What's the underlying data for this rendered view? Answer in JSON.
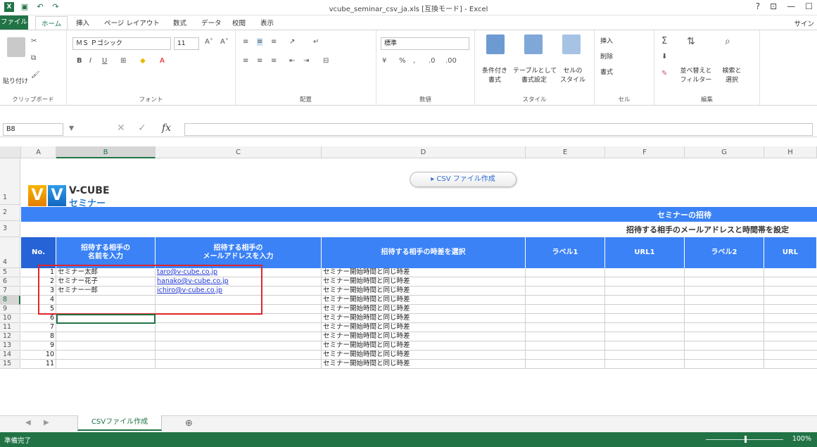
{
  "window": {
    "title": "vcube_seminar_csv_ja.xls [互換モード] - Excel",
    "controls": [
      "?",
      "⊡",
      "—",
      "☐"
    ]
  },
  "tabs": {
    "file": "ファイル",
    "items": [
      "ホーム",
      "挿入",
      "ページ レイアウト",
      "数式",
      "データ",
      "校閲",
      "表示"
    ],
    "signin": "サイン"
  },
  "ribbon": {
    "clipboard": {
      "paste": "貼り付け",
      "label": "クリップボード"
    },
    "font": {
      "name": "ＭＳ Ｐゴシック",
      "size": "11",
      "label": "フォント"
    },
    "alignment": {
      "label": "配置"
    },
    "number": {
      "format": "標準",
      "label": "数値"
    },
    "styles": {
      "conditional": "条件付き\n書式",
      "table": "テーブルとして\n書式設定",
      "cell": "セルの\nスタイル",
      "label": "スタイル"
    },
    "cells": {
      "insert": "挿入",
      "delete": "削除",
      "format": "書式",
      "label": "セル"
    },
    "editing": {
      "sort": "並べ替えと\nフィルター",
      "find": "検索と\n選択",
      "label": "編集"
    }
  },
  "formula": {
    "namebox": "B8",
    "value": ""
  },
  "columns": [
    "A",
    "B",
    "C",
    "D",
    "E",
    "F",
    "G",
    "H"
  ],
  "rows": [
    "1",
    "2",
    "3",
    "4",
    "5",
    "6",
    "7",
    "8",
    "9",
    "10",
    "11",
    "12",
    "13",
    "14",
    "15"
  ],
  "logo": {
    "line1": "V-CUBE",
    "line2": "セミナー"
  },
  "csv_button": "▸ CSV ファイル作成",
  "banner": "セミナーの招待",
  "subtitle": "招待する相手のメールアドレスと時間帯を設定",
  "headers": {
    "no": "No.",
    "name": "招待する相手の\n名前を入力",
    "email": "招待する相手の\nメールアドレスを入力",
    "timezone": "招待する相手の時差を選択",
    "label1": "ラベル1",
    "url1": "URL1",
    "label2": "ラベル2",
    "url2": "URL"
  },
  "records": [
    {
      "no": "1",
      "name": "セミナー太郎",
      "email": "taro@v-cube.co.jp",
      "tz": "セミナー開始時間と同じ時差"
    },
    {
      "no": "2",
      "name": "セミナー花子",
      "email": "hanako@v-cube.co.jp",
      "tz": "セミナー開始時間と同じ時差"
    },
    {
      "no": "3",
      "name": "セミナー一郎",
      "email": "ichiro@v-cube.co.jp",
      "tz": "セミナー開始時間と同じ時差"
    },
    {
      "no": "4",
      "name": "",
      "email": "",
      "tz": "セミナー開始時間と同じ時差"
    },
    {
      "no": "5",
      "name": "",
      "email": "",
      "tz": "セミナー開始時間と同じ時差"
    },
    {
      "no": "6",
      "name": "",
      "email": "",
      "tz": "セミナー開始時間と同じ時差"
    },
    {
      "no": "7",
      "name": "",
      "email": "",
      "tz": "セミナー開始時間と同じ時差"
    },
    {
      "no": "8",
      "name": "",
      "email": "",
      "tz": "セミナー開始時間と同じ時差"
    },
    {
      "no": "9",
      "name": "",
      "email": "",
      "tz": "セミナー開始時間と同じ時差"
    },
    {
      "no": "10",
      "name": "",
      "email": "",
      "tz": "セミナー開始時間と同じ時差"
    },
    {
      "no": "11",
      "name": "",
      "email": "",
      "tz": "セミナー開始時間と同じ時差"
    }
  ],
  "sheet": {
    "tab": "CSVファイル作成",
    "add": "⊕"
  },
  "status": {
    "ready": "準備完了",
    "zoom": "100%"
  }
}
